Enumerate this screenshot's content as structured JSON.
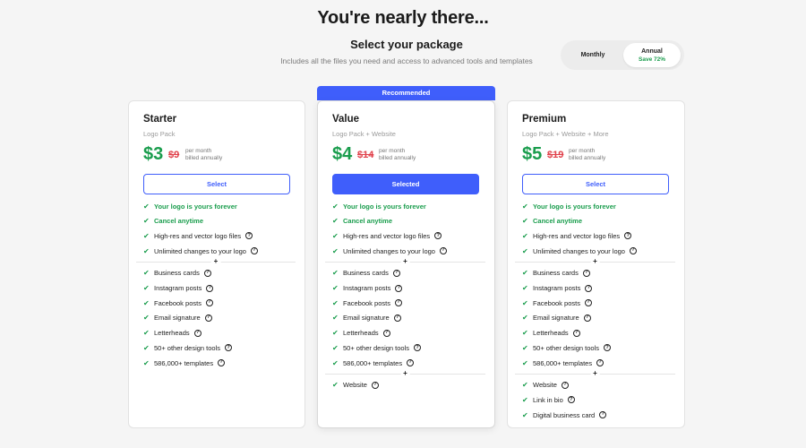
{
  "header": {
    "title": "You're nearly there...",
    "subtitle": "Select your package",
    "description": "Includes all the files you need and access to advanced tools and templates"
  },
  "billing_toggle": {
    "monthly_label": "Monthly",
    "annual_label": "Annual",
    "annual_save": "Save 72%",
    "selected": "Annual"
  },
  "recommended_label": "Recommended",
  "plans": [
    {
      "name": "Starter",
      "subtitle": "Logo Pack",
      "price": "$3",
      "old_price": "$9",
      "note_line1": "per month",
      "note_line2": "billed annually",
      "button_label": "Select",
      "selected": false,
      "groups": [
        [
          {
            "text": "Your logo is yours forever",
            "highlight": true,
            "help": false
          },
          {
            "text": "Cancel anytime",
            "highlight": true,
            "help": false
          },
          {
            "text": "High-res and vector logo files",
            "highlight": false,
            "help": true
          },
          {
            "text": "Unlimited changes to your logo",
            "highlight": false,
            "help": true
          }
        ],
        [
          {
            "text": "Business cards",
            "highlight": false,
            "help": true
          },
          {
            "text": "Instagram posts",
            "highlight": false,
            "help": true
          },
          {
            "text": "Facebook posts",
            "highlight": false,
            "help": true
          },
          {
            "text": "Email signature",
            "highlight": false,
            "help": true
          },
          {
            "text": "Letterheads",
            "highlight": false,
            "help": true
          },
          {
            "text": "50+ other design tools",
            "highlight": false,
            "help": true
          },
          {
            "text": "586,000+ templates",
            "highlight": false,
            "help": true
          }
        ]
      ]
    },
    {
      "name": "Value",
      "subtitle": "Logo Pack + Website",
      "price": "$4",
      "old_price": "$14",
      "note_line1": "per month",
      "note_line2": "billed annually",
      "button_label": "Selected",
      "selected": true,
      "groups": [
        [
          {
            "text": "Your logo is yours forever",
            "highlight": true,
            "help": false
          },
          {
            "text": "Cancel anytime",
            "highlight": true,
            "help": false
          },
          {
            "text": "High-res and vector logo files",
            "highlight": false,
            "help": true
          },
          {
            "text": "Unlimited changes to your logo",
            "highlight": false,
            "help": true
          }
        ],
        [
          {
            "text": "Business cards",
            "highlight": false,
            "help": true
          },
          {
            "text": "Instagram posts",
            "highlight": false,
            "help": true
          },
          {
            "text": "Facebook posts",
            "highlight": false,
            "help": true
          },
          {
            "text": "Email signature",
            "highlight": false,
            "help": true
          },
          {
            "text": "Letterheads",
            "highlight": false,
            "help": true
          },
          {
            "text": "50+ other design tools",
            "highlight": false,
            "help": true
          },
          {
            "text": "586,000+ templates",
            "highlight": false,
            "help": true
          }
        ],
        [
          {
            "text": "Website",
            "highlight": false,
            "help": true
          }
        ]
      ]
    },
    {
      "name": "Premium",
      "subtitle": "Logo Pack + Website + More",
      "price": "$5",
      "old_price": "$19",
      "note_line1": "per month",
      "note_line2": "billed annually",
      "button_label": "Select",
      "selected": false,
      "groups": [
        [
          {
            "text": "Your logo is yours forever",
            "highlight": true,
            "help": false
          },
          {
            "text": "Cancel anytime",
            "highlight": true,
            "help": false
          },
          {
            "text": "High-res and vector logo files",
            "highlight": false,
            "help": true
          },
          {
            "text": "Unlimited changes to your logo",
            "highlight": false,
            "help": true
          }
        ],
        [
          {
            "text": "Business cards",
            "highlight": false,
            "help": true
          },
          {
            "text": "Instagram posts",
            "highlight": false,
            "help": true
          },
          {
            "text": "Facebook posts",
            "highlight": false,
            "help": true
          },
          {
            "text": "Email signature",
            "highlight": false,
            "help": true
          },
          {
            "text": "Letterheads",
            "highlight": false,
            "help": true
          },
          {
            "text": "50+ other design tools",
            "highlight": false,
            "help": true
          },
          {
            "text": "586,000+ templates",
            "highlight": false,
            "help": true
          }
        ],
        [
          {
            "text": "Website",
            "highlight": false,
            "help": true
          },
          {
            "text": "Link in bio",
            "highlight": false,
            "help": true
          },
          {
            "text": "Digital business card",
            "highlight": false,
            "help": true
          }
        ]
      ]
    }
  ],
  "icons": {
    "check": "check-icon",
    "help": "help-icon",
    "plus": "plus-icon"
  },
  "colors": {
    "accent": "#3f5efb",
    "success": "#1a9d4d",
    "old_price": "#e0404a",
    "background": "#f5f5f5"
  }
}
